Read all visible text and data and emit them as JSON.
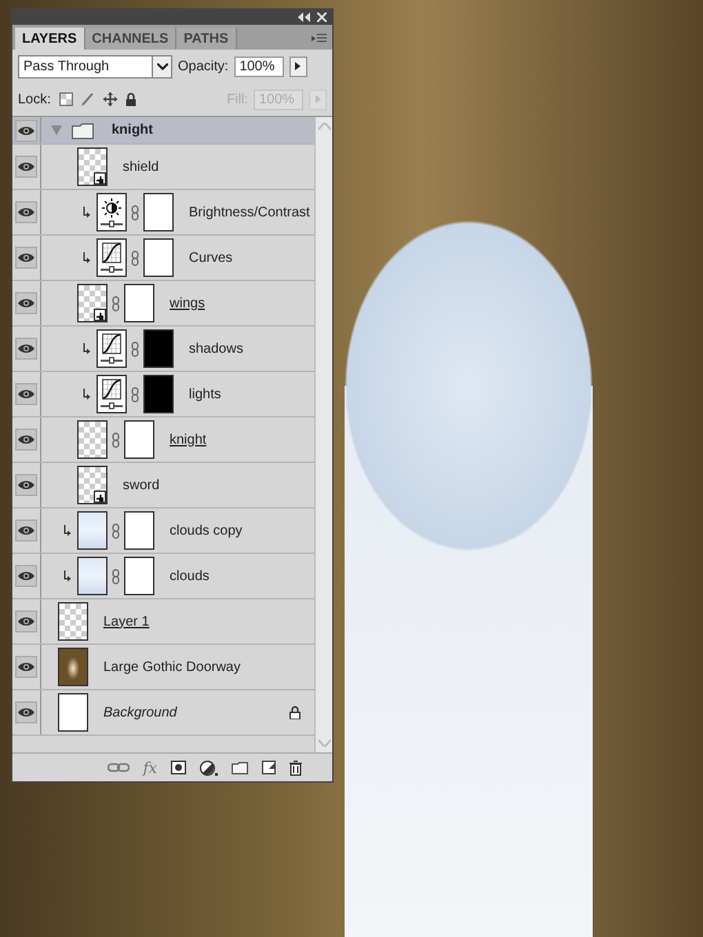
{
  "panel": {
    "tabs": [
      {
        "label": "LAYERS",
        "selected": true
      },
      {
        "label": "CHANNELS",
        "selected": false
      },
      {
        "label": "PATHS",
        "selected": false
      }
    ],
    "blend_mode": "Pass Through",
    "opacity_label": "Opacity:",
    "opacity": "100%",
    "lock_label": "Lock:",
    "fill_label": "Fill:",
    "fill": "100%",
    "fill_disabled": true,
    "layers": [
      {
        "name": "knight",
        "kind": "group",
        "visible": true,
        "selected": true,
        "expanded": true,
        "underlined": false,
        "locked": false,
        "children": [
          {
            "name": "shield",
            "kind": "layer",
            "thumbnail": {
              "kind": "transparent"
            },
            "smart": true,
            "clipped": false,
            "visible": true,
            "selected": false,
            "underlined": false,
            "locked": false
          },
          {
            "name": "Brightness/Contrast",
            "kind": "adjustment",
            "thumbnail": {
              "kind": "brightness"
            },
            "mask": {
              "kind": "white"
            },
            "smart": false,
            "clipped": true,
            "visible": true,
            "selected": false,
            "underlined": false,
            "locked": false
          },
          {
            "name": "Curves",
            "kind": "adjustment",
            "thumbnail": {
              "kind": "curves"
            },
            "mask": {
              "kind": "white"
            },
            "smart": false,
            "clipped": true,
            "visible": true,
            "selected": false,
            "underlined": false,
            "locked": false
          },
          {
            "name": "wings",
            "kind": "layer",
            "thumbnail": {
              "kind": "transparent"
            },
            "mask": {
              "kind": "white"
            },
            "smart": true,
            "clipped": false,
            "visible": true,
            "selected": false,
            "underlined": true,
            "locked": false
          },
          {
            "name": "shadows",
            "kind": "adjustment",
            "thumbnail": {
              "kind": "curves"
            },
            "mask": {
              "kind": "black"
            },
            "smart": false,
            "clipped": true,
            "visible": true,
            "selected": false,
            "underlined": false,
            "locked": false
          },
          {
            "name": "lights",
            "kind": "adjustment",
            "thumbnail": {
              "kind": "curves"
            },
            "mask": {
              "kind": "black"
            },
            "smart": false,
            "clipped": true,
            "visible": true,
            "selected": false,
            "underlined": false,
            "locked": false
          },
          {
            "name": "knight",
            "kind": "layer",
            "thumbnail": {
              "kind": "transparent"
            },
            "mask": {
              "kind": "white"
            },
            "smart": false,
            "clipped": false,
            "visible": true,
            "selected": false,
            "underlined": true,
            "locked": false
          },
          {
            "name": "sword",
            "kind": "layer",
            "thumbnail": {
              "kind": "transparent"
            },
            "smart": true,
            "clipped": false,
            "visible": true,
            "selected": false,
            "underlined": false,
            "locked": false
          },
          {
            "name": "clouds copy",
            "kind": "layer",
            "thumbnail": {
              "kind": "clouds"
            },
            "mask": {
              "kind": "white"
            },
            "smart": false,
            "clipped": true,
            "visible": true,
            "selected": false,
            "underlined": false,
            "locked": false
          },
          {
            "name": "clouds",
            "kind": "layer",
            "thumbnail": {
              "kind": "clouds"
            },
            "mask": {
              "kind": "white"
            },
            "smart": false,
            "clipped": true,
            "visible": true,
            "selected": false,
            "underlined": false,
            "locked": false
          }
        ]
      },
      {
        "name": "Layer 1",
        "kind": "layer",
        "thumbnail": {
          "kind": "transparent"
        },
        "smart": false,
        "clipped": false,
        "visible": true,
        "selected": false,
        "underlined": true,
        "locked": false
      },
      {
        "name": "Large Gothic Doorway",
        "kind": "layer",
        "thumbnail": {
          "kind": "photo"
        },
        "smart": false,
        "clipped": false,
        "visible": true,
        "selected": false,
        "underlined": false,
        "locked": false
      },
      {
        "name": "Background",
        "kind": "background",
        "thumbnail": {
          "kind": "white"
        },
        "smart": false,
        "clipped": false,
        "visible": true,
        "selected": false,
        "underlined": false,
        "locked": true
      }
    ],
    "footer_buttons": [
      {
        "kind": "link"
      },
      {
        "kind": "fx",
        "label": "fx"
      },
      {
        "kind": "mask"
      },
      {
        "kind": "adjustment"
      },
      {
        "kind": "folder"
      },
      {
        "kind": "new"
      },
      {
        "kind": "trash"
      }
    ]
  }
}
